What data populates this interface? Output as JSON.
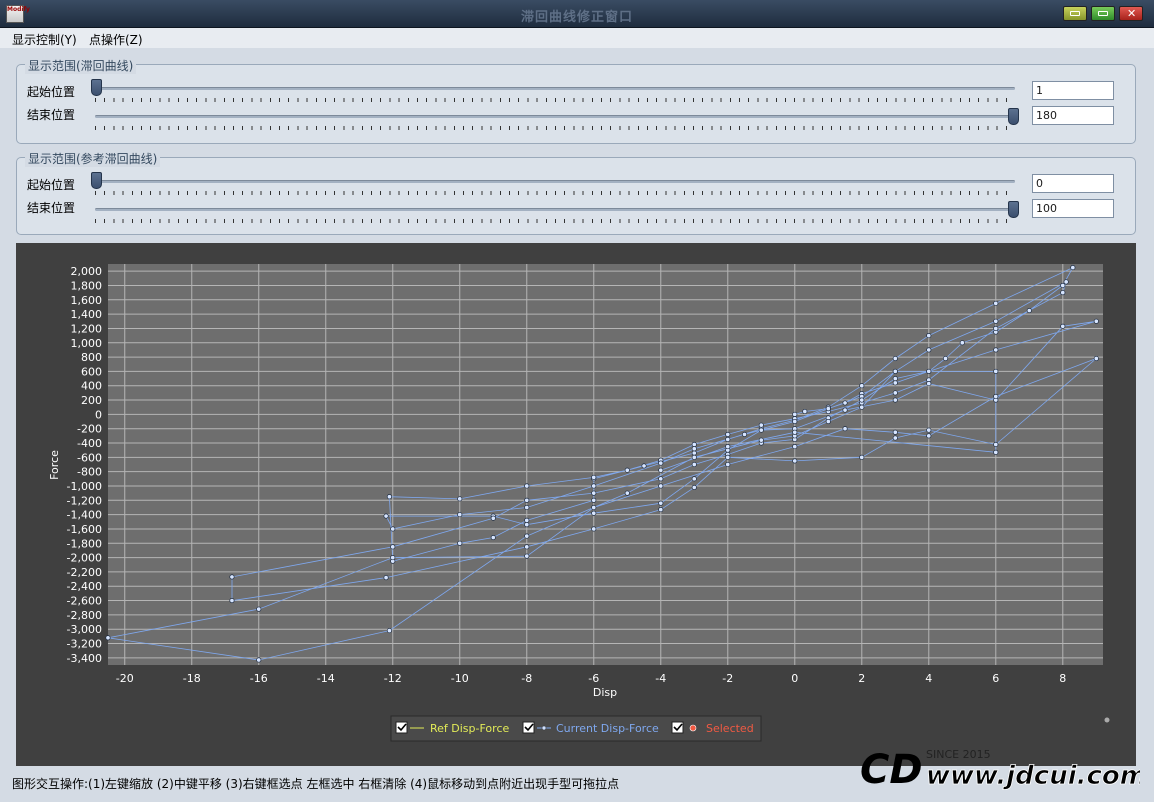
{
  "window": {
    "title": "滞回曲线修正窗口",
    "icon_text": "Modify",
    "close_glyph": "✕"
  },
  "menu": {
    "display": "显示控制(Y)",
    "points": "点操作(Z)"
  },
  "group1": {
    "title": "显示范围(滞回曲线)",
    "start_label": "起始位置",
    "end_label": "结束位置",
    "start_value": "1",
    "end_value": "180"
  },
  "group2": {
    "title": "显示范围(参考滞回曲线)",
    "start_label": "起始位置",
    "end_label": "结束位置",
    "start_value": "0",
    "end_value": "100"
  },
  "legend": {
    "ref": "Ref Disp-Force",
    "current": "Current Disp-Force",
    "selected": "Selected"
  },
  "status": "图形交互操作:(1)左键缩放 (2)中键平移 (3)右键框选点 左框选中 右框清除 (4)鼠标移动到点附近出现手型可拖拉点",
  "watermark": {
    "since": "SINCE 2015",
    "url": "www.jdcui.com",
    "logo": "CD"
  },
  "colors": {
    "plot_bg": "#6e6e6e",
    "series": "#7fa8ef",
    "ref": "#e3ec58",
    "selected": "#f15a43"
  },
  "chart_data": {
    "type": "scatter",
    "xlabel": "Disp",
    "ylabel": "Force",
    "xlim": [
      -20.5,
      9.2
    ],
    "ylim": [
      -3500,
      2100
    ],
    "xticks": [
      -20,
      -18,
      -16,
      -14,
      -12,
      -10,
      -8,
      -6,
      -4,
      -2,
      0,
      2,
      4,
      6,
      8
    ],
    "yticks": [
      2000,
      1800,
      1600,
      1400,
      1200,
      1000,
      800,
      600,
      400,
      200,
      0,
      -200,
      -400,
      -600,
      -800,
      -1000,
      -1200,
      -1400,
      -1600,
      -1800,
      -2000,
      -2200,
      -2400,
      -2600,
      -2800,
      -3000,
      -3200,
      -3400
    ],
    "grid": true,
    "series": [
      {
        "name": "Current Disp-Force",
        "points": [
          [
            0,
            0
          ],
          [
            0.3,
            40
          ],
          [
            1,
            80
          ],
          [
            1.5,
            160
          ],
          [
            2,
            290
          ],
          [
            3,
            440
          ],
          [
            4,
            600
          ],
          [
            4.5,
            780
          ],
          [
            5,
            1000
          ],
          [
            6,
            1150
          ],
          [
            7,
            1450
          ],
          [
            8,
            1800
          ],
          [
            8.3,
            2050
          ],
          [
            6,
            1550
          ],
          [
            4,
            1100
          ],
          [
            3,
            780
          ],
          [
            2,
            400
          ],
          [
            1,
            100
          ],
          [
            0,
            -80
          ],
          [
            -1,
            -200
          ],
          [
            -2,
            -350
          ],
          [
            -3,
            -540
          ],
          [
            -4,
            -660
          ],
          [
            -4.5,
            -720
          ],
          [
            -6,
            -900
          ],
          [
            -6,
            -1200
          ],
          [
            -8,
            -1480
          ],
          [
            -9,
            -1720
          ],
          [
            -10,
            -1800
          ],
          [
            -12,
            -2050
          ],
          [
            -12.1,
            -1150
          ],
          [
            -10,
            -1180
          ],
          [
            -8,
            -1000
          ],
          [
            -6,
            -880
          ],
          [
            -5,
            -780
          ],
          [
            -4,
            -640
          ],
          [
            -3,
            -420
          ],
          [
            -2,
            -280
          ],
          [
            -1,
            -150
          ],
          [
            0,
            -60
          ],
          [
            1,
            40
          ],
          [
            2,
            160
          ],
          [
            3,
            300
          ],
          [
            4,
            480
          ],
          [
            6,
            1200
          ],
          [
            8,
            1700
          ],
          [
            8.1,
            1850
          ],
          [
            6,
            1300
          ],
          [
            4,
            900
          ],
          [
            3,
            600
          ],
          [
            2,
            250
          ],
          [
            1,
            80
          ],
          [
            0,
            -100
          ],
          [
            -1.5,
            -280
          ],
          [
            -3,
            -480
          ],
          [
            -4,
            -680
          ],
          [
            -6,
            -1000
          ],
          [
            -8,
            -1300
          ],
          [
            -10,
            -1400
          ],
          [
            -12,
            -1600
          ],
          [
            -12.2,
            -1420
          ],
          [
            -9,
            -1420
          ],
          [
            -8,
            -1540
          ],
          [
            -6,
            -1380
          ],
          [
            -4,
            -1240
          ],
          [
            -3,
            -900
          ],
          [
            -2,
            -500
          ],
          [
            -1,
            -220
          ],
          [
            0,
            -200
          ],
          [
            1.5,
            60
          ],
          [
            3,
            200
          ],
          [
            4,
            430
          ],
          [
            6,
            200
          ],
          [
            8,
            1230
          ],
          [
            9,
            1300
          ],
          [
            6,
            900
          ],
          [
            4,
            600
          ],
          [
            3,
            500
          ],
          [
            2,
            200
          ],
          [
            1,
            -50
          ],
          [
            0,
            -350
          ],
          [
            -1,
            -400
          ],
          [
            -2,
            -560
          ],
          [
            -3,
            -700
          ],
          [
            -4,
            -900
          ],
          [
            -6,
            -1100
          ],
          [
            -8,
            -1200
          ],
          [
            -9,
            -1450
          ],
          [
            -12,
            -1850
          ],
          [
            -16.8,
            -2270
          ],
          [
            -16.8,
            -2600
          ],
          [
            -12.2,
            -2280
          ],
          [
            -8,
            -1850
          ],
          [
            -6,
            -1600
          ],
          [
            -4,
            -1330
          ],
          [
            -3,
            -1020
          ],
          [
            -2,
            -600
          ],
          [
            0,
            -650
          ],
          [
            2,
            -600
          ],
          [
            3,
            -330
          ],
          [
            4,
            -220
          ],
          [
            6,
            -420
          ],
          [
            9,
            780
          ],
          [
            6,
            250
          ],
          [
            4,
            -300
          ],
          [
            3,
            -250
          ],
          [
            1.5,
            -200
          ],
          [
            0,
            -450
          ],
          [
            -2,
            -700
          ],
          [
            -4,
            -1000
          ],
          [
            -6,
            -1300
          ],
          [
            -8,
            -1980
          ],
          [
            -12,
            -2000
          ],
          [
            -16,
            -2720
          ],
          [
            -20.5,
            -3120
          ],
          [
            -16,
            -3430
          ],
          [
            -12.1,
            -3020
          ],
          [
            -8,
            -1700
          ],
          [
            -5,
            -1100
          ],
          [
            -3,
            -600
          ],
          [
            -1,
            -360
          ],
          [
            0,
            -300
          ],
          [
            1,
            -100
          ],
          [
            2,
            100
          ],
          [
            3,
            600
          ],
          [
            6,
            600
          ],
          [
            6,
            -530
          ],
          [
            0,
            -250
          ],
          [
            -2,
            -450
          ],
          [
            -4,
            -780
          ]
        ]
      }
    ]
  }
}
